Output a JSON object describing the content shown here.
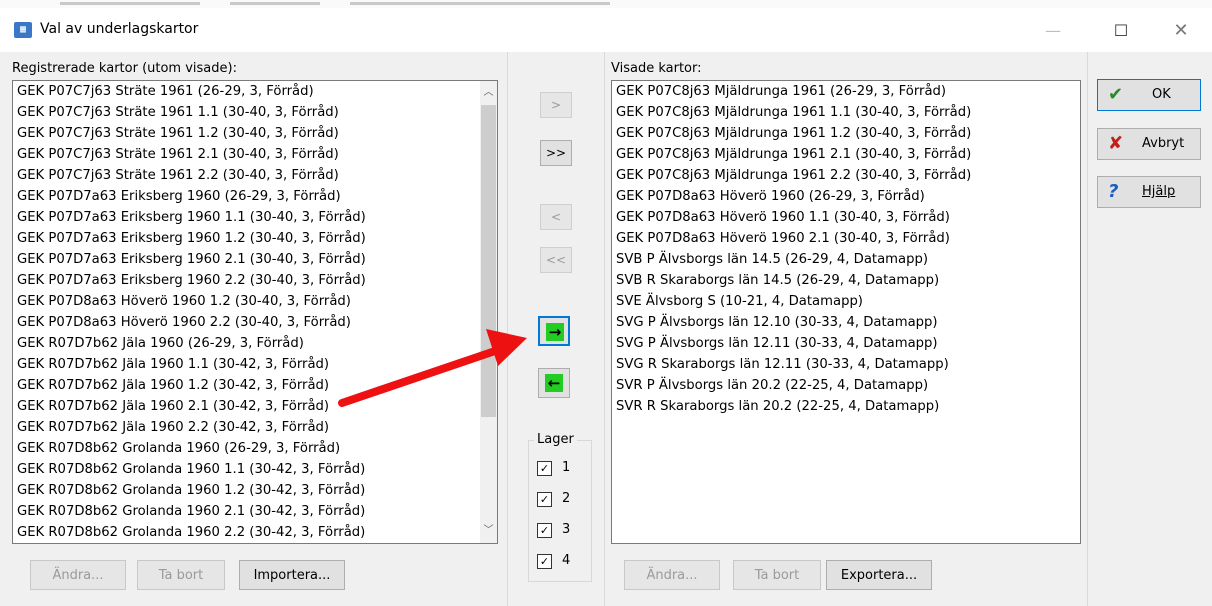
{
  "window": {
    "title": "Val av underlagskartor",
    "icon": "map-app-icon",
    "controls": {
      "minimize": "—",
      "maximize": "☐",
      "close": "✕"
    }
  },
  "left_panel": {
    "label": "Registrerade kartor (utom visade):",
    "items": [
      "GEK P07C7j63 Sträte  1961 (26-29, 3, Förråd)",
      "GEK P07C7j63 Sträte  1961 1.1 (30-40, 3, Förråd)",
      "GEK P07C7j63 Sträte  1961 1.2 (30-40, 3, Förråd)",
      "GEK P07C7j63 Sträte  1961 2.1 (30-40, 3, Förråd)",
      "GEK P07C7j63 Sträte  1961 2.2 (30-40, 3, Förråd)",
      "GEK P07D7a63 Eriksberg 1960 (26-29, 3, Förråd)",
      "GEK P07D7a63 Eriksberg 1960 1.1 (30-40, 3, Förråd)",
      "GEK P07D7a63 Eriksberg 1960 1.2 (30-40, 3, Förråd)",
      "GEK P07D7a63 Eriksberg 1960 2.1 (30-40, 3, Förråd)",
      "GEK P07D7a63 Eriksberg 1960 2.2 (30-40, 3, Förråd)",
      "GEK P07D8a63 Höverö 1960 1.2 (30-40, 3, Förråd)",
      "GEK P07D8a63 Höverö 1960 2.2 (30-40, 3, Förråd)",
      "GEK R07D7b62 Jäla 1960 (26-29, 3, Förråd)",
      "GEK R07D7b62 Jäla 1960 1.1 (30-42, 3, Förråd)",
      "GEK R07D7b62 Jäla 1960 1.2 (30-42, 3, Förråd)",
      "GEK R07D7b62 Jäla 1960 2.1 (30-42, 3, Förråd)",
      "GEK R07D7b62 Jäla 1960 2.2 (30-42, 3, Förråd)",
      "GEK R07D8b62 Grolanda 1960 (26-29, 3, Förråd)",
      "GEK R07D8b62 Grolanda 1960 1.1 (30-42, 3, Förråd)",
      "GEK R07D8b62 Grolanda 1960 1.2 (30-42, 3, Förråd)",
      "GEK R07D8b62 Grolanda 1960 2.1 (30-42, 3, Förråd)",
      "GEK R07D8b62 Grolanda 1960 2.2 (30-42, 3, Förråd)"
    ],
    "buttons": {
      "edit": "Ändra...",
      "delete": "Ta bort",
      "import": "Importera..."
    }
  },
  "middle": {
    "move_one_right": ">",
    "move_all_right": ">>",
    "move_one_left": "<",
    "move_all_left": "<<",
    "move_selected_right": "→",
    "move_selected_left": "←",
    "layer_group": {
      "title": "Lager",
      "items": [
        {
          "label": "1",
          "checked": true
        },
        {
          "label": "2",
          "checked": true
        },
        {
          "label": "3",
          "checked": true
        },
        {
          "label": "4",
          "checked": true
        }
      ]
    }
  },
  "right_panel": {
    "label": "Visade kartor:",
    "items": [
      "GEK P07C8j63 Mjäldrunga 1961 (26-29, 3, Förråd)",
      "GEK P07C8j63 Mjäldrunga 1961 1.1 (30-40, 3, Förråd)",
      "GEK P07C8j63 Mjäldrunga 1961 1.2 (30-40, 3, Förråd)",
      "GEK P07C8j63 Mjäldrunga 1961 2.1 (30-40, 3, Förråd)",
      "GEK P07C8j63 Mjäldrunga 1961 2.2 (30-40, 3, Förråd)",
      "GEK P07D8a63 Höverö 1960 (26-29, 3, Förråd)",
      "GEK P07D8a63 Höverö 1960 1.1 (30-40, 3, Förråd)",
      "GEK P07D8a63 Höverö 1960 2.1 (30-40, 3, Förråd)",
      "SVB P Älvsborgs län 14.5 (26-29, 4, Datamapp)",
      "SVB R Skaraborgs län 14.5 (26-29, 4, Datamapp)",
      "SVE Älvsborg S (10-21, 4, Datamapp)",
      "SVG P Älvsborgs län 12.10 (30-33, 4, Datamapp)",
      "SVG P Älvsborgs län 12.11 (30-33, 4, Datamapp)",
      "SVG R Skaraborgs län 12.11 (30-33, 4, Datamapp)",
      "SVR P Älvsborgs län 20.2 (22-25, 4, Datamapp)",
      "SVR R Skaraborgs län 20.2 (22-25, 4, Datamapp)"
    ],
    "buttons": {
      "edit": "Ändra...",
      "delete": "Ta bort",
      "export": "Exportera..."
    }
  },
  "side_buttons": {
    "ok": {
      "label": "OK",
      "icon": "checkmark-icon"
    },
    "cancel": {
      "label": "Avbryt",
      "icon": "x-icon"
    },
    "help": {
      "label": "Hjälp",
      "icon": "question-icon"
    }
  },
  "colors": {
    "accent": "#0078d7",
    "green_button": "#22cc22",
    "annotation_arrow": "#ee1111",
    "ok_check": "#2a8a2a",
    "cancel_x": "#c0201a",
    "help_question": "#1a5fc0"
  }
}
